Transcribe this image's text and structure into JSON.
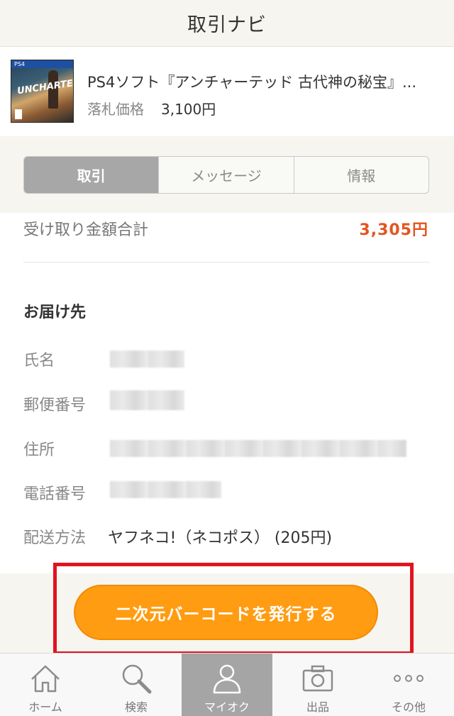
{
  "header": {
    "title": "取引ナビ"
  },
  "item": {
    "name": "PS4ソフト『アンチャーテッド 古代神の秘宝』...",
    "price_label": "落札価格",
    "price_value": "3,100円",
    "thumbnail_icon": "game-case-thumbnail"
  },
  "tabs": [
    {
      "label": "取引",
      "active": true
    },
    {
      "label": "メッセージ",
      "active": false
    },
    {
      "label": "情報",
      "active": false
    }
  ],
  "summary": {
    "total_label": "受け取り金額合計",
    "total_value": "3,305円"
  },
  "delivery": {
    "section_title": "お届け先",
    "name_label": "氏名",
    "postal_label": "郵便番号",
    "address_label": "住所",
    "phone_label": "電話番号",
    "shipping_label": "配送方法",
    "shipping_value": "ヤフネコ!（ネコポス） (205円)"
  },
  "action": {
    "barcode_button": "二次元バーコードを発行する"
  },
  "tabbar": [
    {
      "label": "ホーム",
      "icon": "home-icon",
      "active": false
    },
    {
      "label": "検索",
      "icon": "search-icon",
      "active": false
    },
    {
      "label": "マイオク",
      "icon": "user-icon",
      "active": true
    },
    {
      "label": "出品",
      "icon": "camera-icon",
      "active": false
    },
    {
      "label": "その他",
      "icon": "more-icon",
      "active": false
    }
  ],
  "colors": {
    "accent_orange": "#ff9c12",
    "total_orange": "#e2561f",
    "highlight_red": "#e0141f",
    "active_gray": "#a5a5a5"
  }
}
